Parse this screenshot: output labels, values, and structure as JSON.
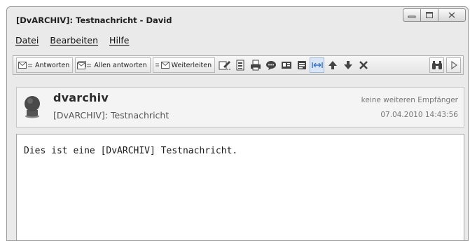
{
  "window": {
    "title": "[DvARCHIV]: Testnachricht - David",
    "controls": [
      "minimize-icon",
      "maximize-icon",
      "close-icon"
    ]
  },
  "menu": {
    "items": [
      {
        "label": "Datei"
      },
      {
        "label": "Bearbeiten"
      },
      {
        "label": "Hilfe"
      }
    ]
  },
  "toolbar": {
    "reply_label": "Antworten",
    "reply_all_label": "Allen antworten",
    "forward_label": "Weiterleiten",
    "icons": [
      "edit-icon",
      "print-preview-icon",
      "printer-icon",
      "speech-bubble-icon",
      "address-card-icon",
      "notes-icon",
      "fit-width-icon",
      "arrow-up-icon",
      "arrow-down-icon",
      "delete-icon",
      "binoculars-icon",
      "expand-arrow-icon"
    ]
  },
  "message": {
    "sender": "dvarchiv",
    "subject": "[DvARCHIV]: Testnachricht",
    "recipients": "keine weiteren Empfänger",
    "date": "07.04.2010 14:43:56",
    "body": "Dies ist eine [DvARCHIV] Testnachricht."
  }
}
